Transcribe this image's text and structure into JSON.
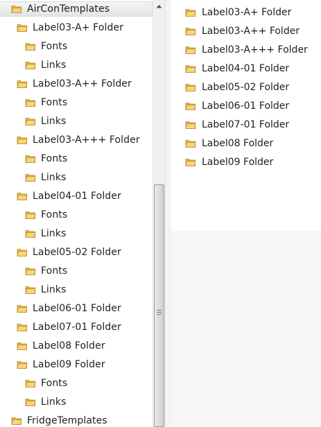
{
  "tree": {
    "items": [
      {
        "label": "AirConTemplates"
      },
      {
        "label": "Label03-A+ Folder"
      },
      {
        "label": "Fonts"
      },
      {
        "label": "Links"
      },
      {
        "label": "Label03-A++ Folder"
      },
      {
        "label": "Fonts"
      },
      {
        "label": "Links"
      },
      {
        "label": "Label03-A+++ Folder"
      },
      {
        "label": "Fonts"
      },
      {
        "label": "Links"
      },
      {
        "label": "Label04-01 Folder"
      },
      {
        "label": "Fonts"
      },
      {
        "label": "Links"
      },
      {
        "label": "Label05-02 Folder"
      },
      {
        "label": "Fonts"
      },
      {
        "label": "Links"
      },
      {
        "label": "Label06-01 Folder"
      },
      {
        "label": "Label07-01 Folder"
      },
      {
        "label": "Label08 Folder"
      },
      {
        "label": "Label09 Folder"
      },
      {
        "label": "Fonts"
      },
      {
        "label": "Links"
      },
      {
        "label": "FridgeTemplates"
      }
    ]
  },
  "content": {
    "items": [
      {
        "label": "Label03-A+ Folder"
      },
      {
        "label": "Label03-A++ Folder"
      },
      {
        "label": "Label03-A+++ Folder"
      },
      {
        "label": "Label04-01 Folder"
      },
      {
        "label": "Label05-02 Folder"
      },
      {
        "label": "Label06-01 Folder"
      },
      {
        "label": "Label07-01 Folder"
      },
      {
        "label": "Label08 Folder"
      },
      {
        "label": "Label09 Folder"
      }
    ]
  },
  "icons": {
    "folder": "folder-icon",
    "scroll_up": "scroll-up-arrow-icon",
    "grip": "scrollbar-grip-icon"
  },
  "colors": {
    "folder_body": "#f5d67a",
    "folder_back": "#e2b54a",
    "folder_edge": "#b8892a",
    "selection": "#e8e8e8",
    "scrollbar_track": "#f0f0f0"
  }
}
